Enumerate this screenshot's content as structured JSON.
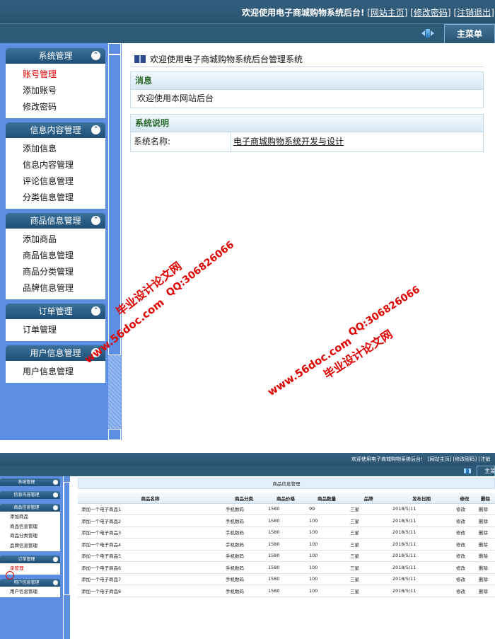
{
  "header": {
    "welcome": "欢迎使用电子商城购物系统后台!",
    "links": [
      "网站主页",
      "修改密码",
      "注销退出"
    ],
    "main_menu_tab": "主菜单"
  },
  "sidebar": {
    "groups": [
      {
        "title": "系统管理",
        "items": [
          "账号管理",
          "添加账号",
          "修改密码"
        ]
      },
      {
        "title": "信息内容管理",
        "items": [
          "添加信息",
          "信息内容管理",
          "评论信息管理",
          "分类信息管理"
        ]
      },
      {
        "title": "商品信息管理",
        "items": [
          "添加商品",
          "商品信息管理",
          "商品分类管理",
          "品牌信息管理"
        ]
      },
      {
        "title": "订单管理",
        "items": [
          "订单管理"
        ]
      },
      {
        "title": "用户信息管理",
        "items": [
          "用户信息管理"
        ]
      }
    ],
    "active_item": "账号管理"
  },
  "content": {
    "title": "欢迎使用电子商城购物系统后台管理系统",
    "message_panel": {
      "title": "消息",
      "body": "欢迎使用本网站后台"
    },
    "system_panel": {
      "title": "系统说明",
      "key": "系统名称:",
      "value": "电子商城购物系统开发与设计"
    }
  },
  "watermarks": {
    "a": "毕业设计论文网",
    "b": "www.56doc.com",
    "c": "QQ:306826066"
  },
  "screen2": {
    "header": {
      "welcome": "欢迎使用电子商城购物系统后台!",
      "links": [
        "网站主页",
        "修改密码",
        "注销"
      ],
      "main_menu_tab": "主菜"
    },
    "sidebar": {
      "collapsed": [
        "系统管理",
        "信息内容管理"
      ],
      "product_group": {
        "title": "商品信息管理",
        "items": [
          "添加商品",
          "商品信息管理",
          "商品分类管理",
          "品牌信息管理"
        ]
      },
      "order_group": {
        "title": "订单管理",
        "items": [
          "单管理"
        ]
      },
      "user_group": {
        "title": "用户信息管理",
        "items": [
          "用户信息管理"
        ]
      }
    },
    "page_title": "商品信息管理",
    "table": {
      "columns": [
        "商品名称",
        "商品分类",
        "商品价格",
        "商品数量",
        "品牌",
        "发布日期",
        "修改",
        "删除"
      ],
      "rows": [
        [
          "添加一个电子商品1",
          "手机数码",
          "1580",
          "99",
          "三星",
          "2018/5/11",
          "修改",
          "删除"
        ],
        [
          "添加一个电子商品2",
          "手机数码",
          "1580",
          "100",
          "三星",
          "2018/5/11",
          "修改",
          "删除"
        ],
        [
          "添加一个电子商品3",
          "手机数码",
          "1580",
          "100",
          "三星",
          "2018/5/11",
          "修改",
          "删除"
        ],
        [
          "添加一个电子商品4",
          "手机数码",
          "1580",
          "100",
          "三星",
          "2018/5/11",
          "修改",
          "删除"
        ],
        [
          "添加一个电子商品5",
          "手机数码",
          "1580",
          "100",
          "三星",
          "2018/5/11",
          "修改",
          "删除"
        ],
        [
          "添加一个电子商品6",
          "手机数码",
          "1580",
          "100",
          "三星",
          "2018/5/11",
          "修改",
          "删除"
        ],
        [
          "添加一个电子商品7",
          "手机数码",
          "1580",
          "100",
          "三星",
          "2018/5/11",
          "修改",
          "删除"
        ],
        [
          "添加一个电子商品8",
          "手机数码",
          "1580",
          "100",
          "三星",
          "2018/5/11",
          "修改",
          "删除"
        ]
      ]
    }
  }
}
